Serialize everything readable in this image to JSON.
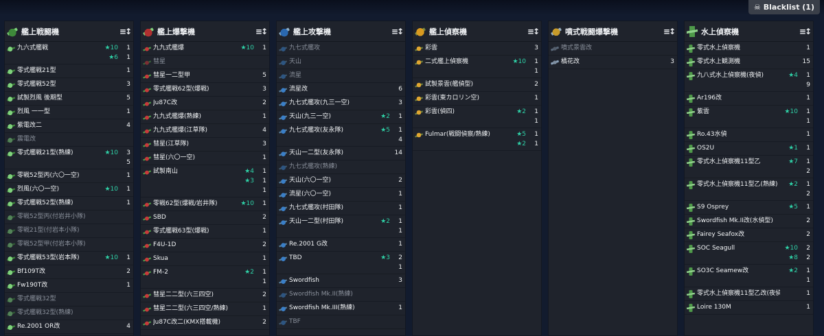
{
  "blacklist": {
    "icon": "skull-crossbones-icon",
    "label": "Blacklist (1)"
  },
  "columns": [
    {
      "title": "艦上戦闘機",
      "icon": "fighter",
      "rows": [
        {
          "name": "九六式艦戦",
          "dim": false,
          "lines": [
            {
              "star": "★10",
              "count": "1"
            },
            {
              "star": "★6",
              "count": "1"
            }
          ]
        },
        {
          "name": "零式艦戦21型",
          "dim": false,
          "lines": [
            {
              "star": "",
              "count": "1"
            }
          ]
        },
        {
          "name": "零式艦戦52型",
          "dim": false,
          "lines": [
            {
              "star": "",
              "count": "3"
            }
          ]
        },
        {
          "name": "試製烈風 後期型",
          "dim": false,
          "lines": [
            {
              "star": "",
              "count": "5"
            }
          ]
        },
        {
          "name": "烈風 一一型",
          "dim": false,
          "lines": [
            {
              "star": "",
              "count": "1"
            }
          ]
        },
        {
          "name": "紫電改二",
          "dim": false,
          "lines": [
            {
              "star": "",
              "count": "4"
            }
          ]
        },
        {
          "name": "震電改",
          "dim": true,
          "lines": [
            {
              "star": "",
              "count": ""
            }
          ]
        },
        {
          "name": "零式艦戦21型(熟練)",
          "dim": false,
          "lines": [
            {
              "star": "★10",
              "count": "3"
            },
            {
              "star": "",
              "count": "5"
            }
          ]
        },
        {
          "name": "零戦52型丙(六〇一空)",
          "dim": false,
          "lines": [
            {
              "star": "",
              "count": "1"
            }
          ]
        },
        {
          "name": "烈風(六〇一空)",
          "dim": false,
          "lines": [
            {
              "star": "★10",
              "count": "1"
            }
          ]
        },
        {
          "name": "零式艦戦52型(熟練)",
          "dim": false,
          "lines": [
            {
              "star": "",
              "count": "1"
            }
          ]
        },
        {
          "name": "零戦52型丙(付岩井小隊)",
          "dim": true,
          "lines": [
            {
              "star": "",
              "count": ""
            }
          ]
        },
        {
          "name": "零戦21型(付岩本小隊)",
          "dim": true,
          "lines": [
            {
              "star": "",
              "count": ""
            }
          ]
        },
        {
          "name": "零戦52型甲(付岩本小隊)",
          "dim": true,
          "lines": [
            {
              "star": "",
              "count": ""
            }
          ]
        },
        {
          "name": "零式艦戦53型(岩本隊)",
          "dim": false,
          "lines": [
            {
              "star": "★10",
              "count": "1"
            }
          ]
        },
        {
          "name": "Bf109T改",
          "dim": false,
          "lines": [
            {
              "star": "",
              "count": "2"
            }
          ]
        },
        {
          "name": "Fw190T改",
          "dim": false,
          "lines": [
            {
              "star": "",
              "count": "1"
            }
          ]
        },
        {
          "name": "零式艦戦32型",
          "dim": true,
          "lines": [
            {
              "star": "",
              "count": ""
            }
          ]
        },
        {
          "name": "零式艦戦32型(熟練)",
          "dim": true,
          "lines": [
            {
              "star": "",
              "count": ""
            }
          ]
        },
        {
          "name": "Re.2001 OR改",
          "dim": false,
          "lines": [
            {
              "star": "",
              "count": "4"
            }
          ]
        }
      ]
    },
    {
      "title": "艦上爆撃機",
      "icon": "bomber",
      "rows": [
        {
          "name": "九九式艦爆",
          "dim": false,
          "lines": [
            {
              "star": "★10",
              "count": "1"
            }
          ]
        },
        {
          "name": "彗星",
          "dim": true,
          "lines": [
            {
              "star": "",
              "count": ""
            }
          ]
        },
        {
          "name": "彗星一二型甲",
          "dim": false,
          "lines": [
            {
              "star": "",
              "count": "5"
            }
          ]
        },
        {
          "name": "零式艦戦62型(爆戦)",
          "dim": false,
          "lines": [
            {
              "star": "",
              "count": "3"
            }
          ]
        },
        {
          "name": "Ju87C改",
          "dim": false,
          "lines": [
            {
              "star": "",
              "count": "2"
            }
          ]
        },
        {
          "name": "九九式艦爆(熟練)",
          "dim": false,
          "lines": [
            {
              "star": "",
              "count": "1"
            }
          ]
        },
        {
          "name": "九九式艦爆(江草隊)",
          "dim": false,
          "lines": [
            {
              "star": "",
              "count": "4"
            }
          ]
        },
        {
          "name": "彗星(江草隊)",
          "dim": false,
          "lines": [
            {
              "star": "",
              "count": "3"
            }
          ]
        },
        {
          "name": "彗星(六〇一空)",
          "dim": false,
          "lines": [
            {
              "star": "",
              "count": "1"
            }
          ]
        },
        {
          "name": "試製南山",
          "dim": false,
          "lines": [
            {
              "star": "★4",
              "count": "1"
            },
            {
              "star": "★3",
              "count": "1"
            },
            {
              "star": "",
              "count": "1"
            }
          ]
        },
        {
          "name": "零戦62型(爆戦/岩井隊)",
          "dim": false,
          "lines": [
            {
              "star": "★10",
              "count": "1"
            }
          ]
        },
        {
          "name": "SBD",
          "dim": false,
          "lines": [
            {
              "star": "",
              "count": "2"
            }
          ]
        },
        {
          "name": "零式艦戦63型(爆戦)",
          "dim": false,
          "lines": [
            {
              "star": "",
              "count": "1"
            }
          ]
        },
        {
          "name": "F4U-1D",
          "dim": false,
          "lines": [
            {
              "star": "",
              "count": "2"
            }
          ]
        },
        {
          "name": "Skua",
          "dim": false,
          "lines": [
            {
              "star": "",
              "count": "1"
            }
          ]
        },
        {
          "name": "FM-2",
          "dim": false,
          "lines": [
            {
              "star": "★2",
              "count": "1"
            },
            {
              "star": "",
              "count": "1"
            }
          ]
        },
        {
          "name": "彗星二二型(六三四空)",
          "dim": false,
          "lines": [
            {
              "star": "",
              "count": "2"
            }
          ]
        },
        {
          "name": "彗星二二型(六三四空/熟練)",
          "dim": false,
          "lines": [
            {
              "star": "",
              "count": "1"
            }
          ]
        },
        {
          "name": "Ju87C改二(KMX搭載機)",
          "dim": false,
          "lines": [
            {
              "star": "",
              "count": "2"
            }
          ]
        }
      ]
    },
    {
      "title": "艦上攻撃機",
      "icon": "torpedo",
      "rows": [
        {
          "name": "九七式艦攻",
          "dim": true,
          "lines": [
            {
              "star": "",
              "count": ""
            }
          ]
        },
        {
          "name": "天山",
          "dim": true,
          "lines": [
            {
              "star": "",
              "count": ""
            }
          ]
        },
        {
          "name": "流星",
          "dim": true,
          "lines": [
            {
              "star": "",
              "count": ""
            }
          ]
        },
        {
          "name": "流星改",
          "dim": false,
          "lines": [
            {
              "star": "",
              "count": "6"
            }
          ]
        },
        {
          "name": "九七式艦攻(九三一空)",
          "dim": false,
          "lines": [
            {
              "star": "",
              "count": "3"
            }
          ]
        },
        {
          "name": "天山(九三一空)",
          "dim": false,
          "lines": [
            {
              "star": "★2",
              "count": "1"
            }
          ]
        },
        {
          "name": "九七式艦攻(友永隊)",
          "dim": false,
          "lines": [
            {
              "star": "★5",
              "count": "1"
            },
            {
              "star": "",
              "count": "4"
            }
          ]
        },
        {
          "name": "天山一二型(友永隊)",
          "dim": false,
          "lines": [
            {
              "star": "",
              "count": "14"
            }
          ]
        },
        {
          "name": "九七式艦攻(熟練)",
          "dim": true,
          "lines": [
            {
              "star": "",
              "count": ""
            }
          ]
        },
        {
          "name": "天山(六〇一空)",
          "dim": false,
          "lines": [
            {
              "star": "",
              "count": "2"
            }
          ]
        },
        {
          "name": "流星(六〇一空)",
          "dim": false,
          "lines": [
            {
              "star": "",
              "count": "1"
            }
          ]
        },
        {
          "name": "九七式艦攻(村田隊)",
          "dim": false,
          "lines": [
            {
              "star": "",
              "count": "1"
            }
          ]
        },
        {
          "name": "天山一二型(村田隊)",
          "dim": false,
          "lines": [
            {
              "star": "★2",
              "count": "1"
            },
            {
              "star": "",
              "count": "1"
            }
          ]
        },
        {
          "name": "Re.2001 G改",
          "dim": false,
          "lines": [
            {
              "star": "",
              "count": "1"
            }
          ]
        },
        {
          "name": "TBD",
          "dim": false,
          "lines": [
            {
              "star": "★3",
              "count": "2"
            },
            {
              "star": "",
              "count": "1"
            }
          ]
        },
        {
          "name": "Swordfish",
          "dim": false,
          "lines": [
            {
              "star": "",
              "count": "3"
            }
          ]
        },
        {
          "name": "Swordfish Mk.II(熟練)",
          "dim": true,
          "lines": [
            {
              "star": "",
              "count": ""
            }
          ]
        },
        {
          "name": "Swordfish Mk.III(熟練)",
          "dim": false,
          "lines": [
            {
              "star": "",
              "count": "1"
            }
          ]
        },
        {
          "name": "TBF",
          "dim": true,
          "lines": [
            {
              "star": "",
              "count": ""
            }
          ]
        }
      ]
    },
    {
      "title": "艦上偵察機",
      "icon": "recon",
      "rows": [
        {
          "name": "彩雲",
          "dim": false,
          "lines": [
            {
              "star": "",
              "count": "3"
            }
          ]
        },
        {
          "name": "二式艦上偵察機",
          "dim": false,
          "lines": [
            {
              "star": "★10",
              "count": "1"
            },
            {
              "star": "",
              "count": "1"
            }
          ]
        },
        {
          "name": "試製景雲(艦偵型)",
          "dim": false,
          "lines": [
            {
              "star": "",
              "count": "2"
            }
          ]
        },
        {
          "name": "彩雲(東カロリン空)",
          "dim": false,
          "lines": [
            {
              "star": "",
              "count": "1"
            }
          ]
        },
        {
          "name": "彩雲(偵四)",
          "dim": false,
          "lines": [
            {
              "star": "★2",
              "count": "1"
            },
            {
              "star": "",
              "count": "1"
            }
          ]
        },
        {
          "name": "Fulmar(戦闘偵察/熟練)",
          "dim": false,
          "lines": [
            {
              "star": "★5",
              "count": "1"
            },
            {
              "star": "★2",
              "count": "1"
            }
          ]
        }
      ]
    },
    {
      "title": "噴式戦闘爆撃機",
      "icon": "jet",
      "rows": [
        {
          "name": "噴式景雲改",
          "dim": true,
          "lines": [
            {
              "star": "",
              "count": ""
            }
          ]
        },
        {
          "name": "橘花改",
          "dim": false,
          "lines": [
            {
              "star": "",
              "count": "3"
            }
          ]
        }
      ]
    },
    {
      "title": "水上偵察機",
      "icon": "seaplane",
      "rows": [
        {
          "name": "零式水上偵察機",
          "dim": false,
          "lines": [
            {
              "star": "",
              "count": "1"
            }
          ]
        },
        {
          "name": "零式水上観測機",
          "dim": false,
          "lines": [
            {
              "star": "",
              "count": "15"
            }
          ]
        },
        {
          "name": "九八式水上偵察機(夜偵)",
          "dim": false,
          "lines": [
            {
              "star": "★4",
              "count": "1"
            },
            {
              "star": "",
              "count": "9"
            }
          ]
        },
        {
          "name": "Ar196改",
          "dim": false,
          "lines": [
            {
              "star": "",
              "count": "1"
            }
          ]
        },
        {
          "name": "紫雲",
          "dim": false,
          "lines": [
            {
              "star": "★10",
              "count": "1"
            },
            {
              "star": "",
              "count": "1"
            }
          ]
        },
        {
          "name": "Ro.43水偵",
          "dim": false,
          "lines": [
            {
              "star": "",
              "count": "1"
            }
          ]
        },
        {
          "name": "OS2U",
          "dim": false,
          "lines": [
            {
              "star": "★1",
              "count": "1"
            }
          ]
        },
        {
          "name": "零式水上偵察機11型乙",
          "dim": false,
          "lines": [
            {
              "star": "★7",
              "count": "1"
            },
            {
              "star": "",
              "count": "2"
            }
          ]
        },
        {
          "name": "零式水上偵察機11型乙(熟練)",
          "dim": false,
          "lines": [
            {
              "star": "★2",
              "count": "1"
            },
            {
              "star": "",
              "count": "2"
            }
          ]
        },
        {
          "name": "S9 Osprey",
          "dim": false,
          "lines": [
            {
              "star": "★5",
              "count": "1"
            }
          ]
        },
        {
          "name": "Swordfish Mk.II改(水偵型)",
          "dim": false,
          "lines": [
            {
              "star": "",
              "count": "2"
            }
          ]
        },
        {
          "name": "Fairey Seafox改",
          "dim": false,
          "lines": [
            {
              "star": "",
              "count": "2"
            }
          ]
        },
        {
          "name": "SOC Seagull",
          "dim": false,
          "lines": [
            {
              "star": "★10",
              "count": "2"
            },
            {
              "star": "★8",
              "count": "2"
            }
          ]
        },
        {
          "name": "SO3C Seamew改",
          "dim": false,
          "lines": [
            {
              "star": "★2",
              "count": "1"
            },
            {
              "star": "",
              "count": "1"
            }
          ]
        },
        {
          "name": "零式水上偵察機11型乙改(夜偵)",
          "dim": false,
          "lines": [
            {
              "star": "",
              "count": "1"
            }
          ]
        },
        {
          "name": "Loire 130M",
          "dim": false,
          "lines": [
            {
              "star": "",
              "count": "1"
            }
          ]
        }
      ]
    }
  ],
  "sort_icon": "sort-icon",
  "sort_glyph": "≡↕"
}
